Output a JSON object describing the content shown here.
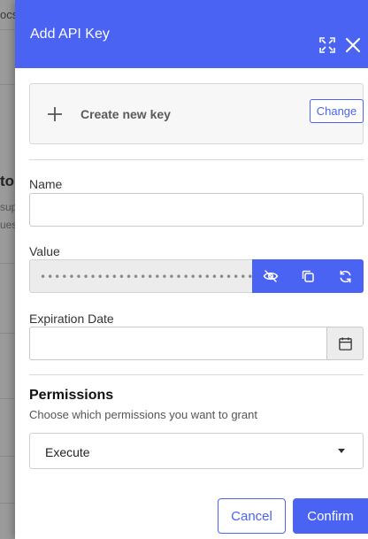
{
  "background": {
    "snippets": [
      "ocs",
      "tor",
      "sup",
      "ues"
    ]
  },
  "dialog": {
    "title": "Add API Key",
    "header_color": "#4a63f2",
    "expand_icon": "expand-icon",
    "close_icon": "close-icon"
  },
  "create_key": {
    "label": "Create new key",
    "change_label": "Change"
  },
  "form": {
    "name_label": "Name",
    "name_value": "",
    "value_label": "Value",
    "value_masked": "••••••••••••••••••••••••••••••••",
    "value_actions": [
      "eye-off-icon",
      "copy-icon",
      "refresh-icon"
    ],
    "expiration_label": "Expiration Date",
    "expiration_value": ""
  },
  "permissions": {
    "title": "Permissions",
    "subtitle": "Choose which permissions you want to grant",
    "selected": "Execute"
  },
  "footer": {
    "cancel_label": "Cancel",
    "confirm_label": "Confirm"
  }
}
